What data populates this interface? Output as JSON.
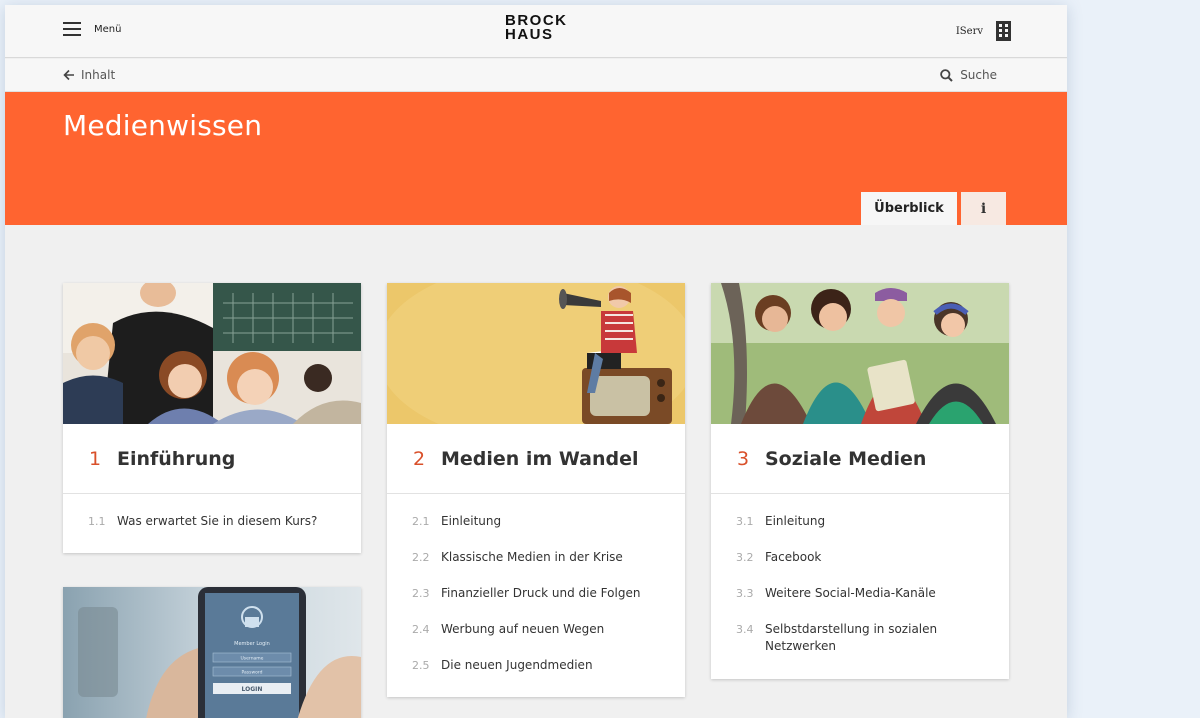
{
  "topbar": {
    "menu_label": "Menü",
    "logo_line1": "BROCK",
    "logo_line2": "HAUS",
    "account_label": "IServ"
  },
  "navbar": {
    "back_label": "Inhalt",
    "search_label": "Suche"
  },
  "header": {
    "title": "Medienwissen",
    "tab_overview": "Überblick",
    "tab_info": "i",
    "accent": "#ff6430"
  },
  "cards": [
    {
      "number": "1",
      "title": "Einführung",
      "items": [
        {
          "number": "1.1",
          "label": "Was erwartet Sie in diesem Kurs?"
        }
      ]
    },
    {
      "number": "2",
      "title": "Medien im Wandel",
      "items": [
        {
          "number": "2.1",
          "label": "Einleitung"
        },
        {
          "number": "2.2",
          "label": "Klassische Medien in der Krise"
        },
        {
          "number": "2.3",
          "label": "Finanzieller Druck und die Folgen"
        },
        {
          "number": "2.4",
          "label": "Werbung auf neuen Wegen"
        },
        {
          "number": "2.5",
          "label": "Die neuen Jugendmedien"
        }
      ]
    },
    {
      "number": "3",
      "title": "Soziale Medien",
      "items": [
        {
          "number": "3.1",
          "label": "Einleitung"
        },
        {
          "number": "3.2",
          "label": "Facebook"
        },
        {
          "number": "3.3",
          "label": "Weitere Social-Media-Kanäle"
        },
        {
          "number": "3.4",
          "label": "Selbstdarstellung in sozialen Netzwerken"
        }
      ]
    }
  ],
  "phone_screen": {
    "title": "Member Login",
    "username_placeholder": "Username",
    "password_placeholder": "Password",
    "login_label": "LOGIN"
  }
}
